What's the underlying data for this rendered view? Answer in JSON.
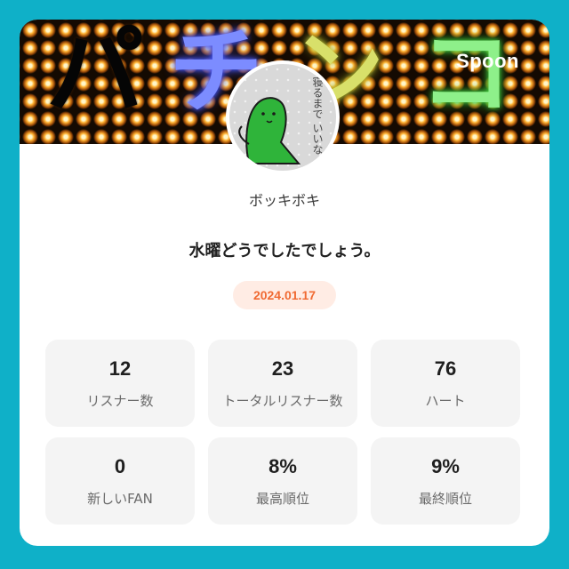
{
  "banner": {
    "chars": [
      "パ",
      "チ",
      "ン",
      "コ"
    ],
    "brand": "Spoon"
  },
  "avatar": {
    "handwriting": [
      "寝るまで",
      "いいな"
    ]
  },
  "profile": {
    "username": "ボッキボキ"
  },
  "post": {
    "title": "水曜どうでしたでしょう。",
    "date": "2024.01.17"
  },
  "stats": [
    {
      "value": "12",
      "label": "リスナー数"
    },
    {
      "value": "23",
      "label": "トータルリスナー数"
    },
    {
      "value": "76",
      "label": "ハート"
    },
    {
      "value": "0",
      "label": "新しいFAN"
    },
    {
      "value": "8%",
      "label": "最高順位"
    },
    {
      "value": "9%",
      "label": "最終順位"
    }
  ],
  "colors": {
    "background": "#0fb0c8",
    "date_text": "#f06a32",
    "date_pill": "#ffece4",
    "stat_tile": "#f4f4f4"
  }
}
